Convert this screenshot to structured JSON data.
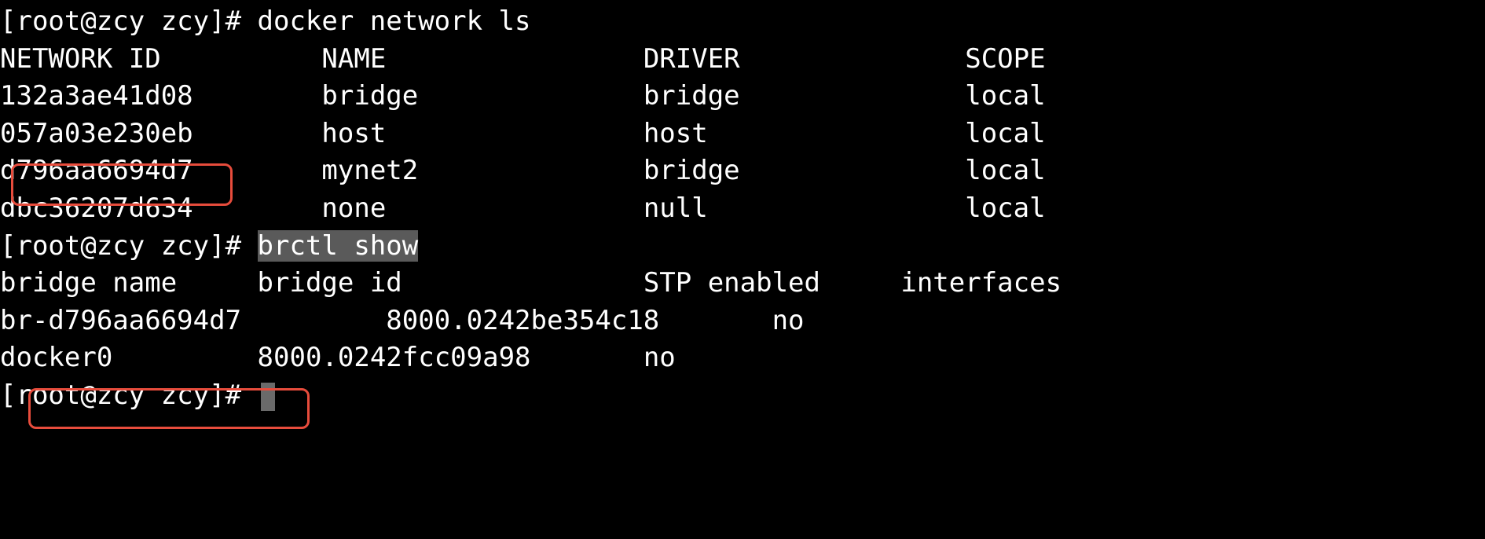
{
  "prompt": "[root@zcy zcy]# ",
  "commands": {
    "docker_network_ls": "docker network ls",
    "brctl_show": "brctl show"
  },
  "docker_network": {
    "headers": {
      "id": "NETWORK ID",
      "name": "NAME",
      "driver": "DRIVER",
      "scope": "SCOPE"
    },
    "rows": [
      {
        "id": "132a3ae41d08",
        "name": "bridge",
        "driver": "bridge",
        "scope": "local"
      },
      {
        "id": "057a03e230eb",
        "name": "host",
        "driver": "host",
        "scope": "local"
      },
      {
        "id": "d796aa6694d7",
        "name": "mynet2",
        "driver": "bridge",
        "scope": "local"
      },
      {
        "id": "dbc36207d634",
        "name": "none",
        "driver": "null",
        "scope": "local"
      }
    ]
  },
  "brctl": {
    "headers": {
      "name": "bridge name",
      "id": "bridge id",
      "stp": "STP enabled",
      "interfaces": "interfaces"
    },
    "rows": [
      {
        "name": "br-d796aa6694d7",
        "id": "8000.0242be354c18",
        "stp": "no",
        "interfaces": ""
      },
      {
        "name": "docker0",
        "id": "8000.0242fcc09a98",
        "stp": "no",
        "interfaces": ""
      }
    ]
  }
}
